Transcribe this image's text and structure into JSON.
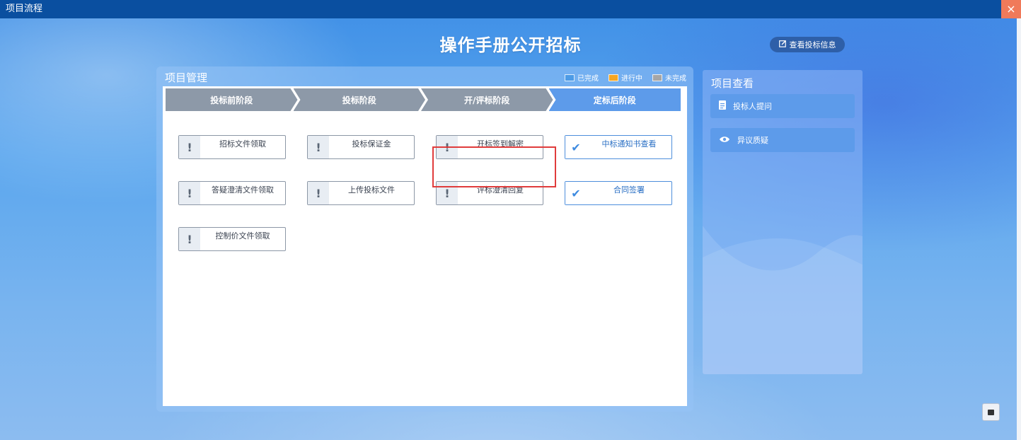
{
  "window": {
    "title": "项目流程",
    "close_icon": "×"
  },
  "header": {
    "title": "操作手册公开招标",
    "view_bid_label": "查看投标信息",
    "view_bid_icon": "edit-icon"
  },
  "management": {
    "title": "项目管理",
    "legend": [
      {
        "label": "已完成",
        "color": "#4d9be6"
      },
      {
        "label": "进行中",
        "color": "#f5a623"
      },
      {
        "label": "未完成",
        "color": "#a6a6a6"
      }
    ],
    "stages": [
      {
        "label": "投标前阶段",
        "state": "grey"
      },
      {
        "label": "投标阶段",
        "state": "grey"
      },
      {
        "label": "开/评标阶段",
        "state": "grey"
      },
      {
        "label": "定标后阶段",
        "state": "blue"
      }
    ],
    "tasks": [
      {
        "label": "招标文件领取",
        "icon": "!",
        "done": false
      },
      {
        "label": "投标保证金",
        "icon": "!",
        "done": false
      },
      {
        "label": "开标签到解密",
        "icon": "!",
        "done": false
      },
      {
        "label": "中标通知书查看",
        "icon": "✔",
        "done": true
      },
      {
        "label": "答疑澄清文件领取",
        "icon": "!",
        "done": false
      },
      {
        "label": "上传投标文件",
        "icon": "!",
        "done": false
      },
      {
        "label": "评标澄清回复",
        "icon": "!",
        "done": false
      },
      {
        "label": "合同签署",
        "icon": "✔",
        "done": true
      },
      {
        "label": "控制价文件领取",
        "icon": "!",
        "done": false
      }
    ]
  },
  "view_panel": {
    "title": "项目查看",
    "buttons": [
      {
        "label": "投标人提问",
        "icon": "document-icon"
      },
      {
        "label": "异议质疑",
        "icon": "eye-icon"
      }
    ]
  }
}
